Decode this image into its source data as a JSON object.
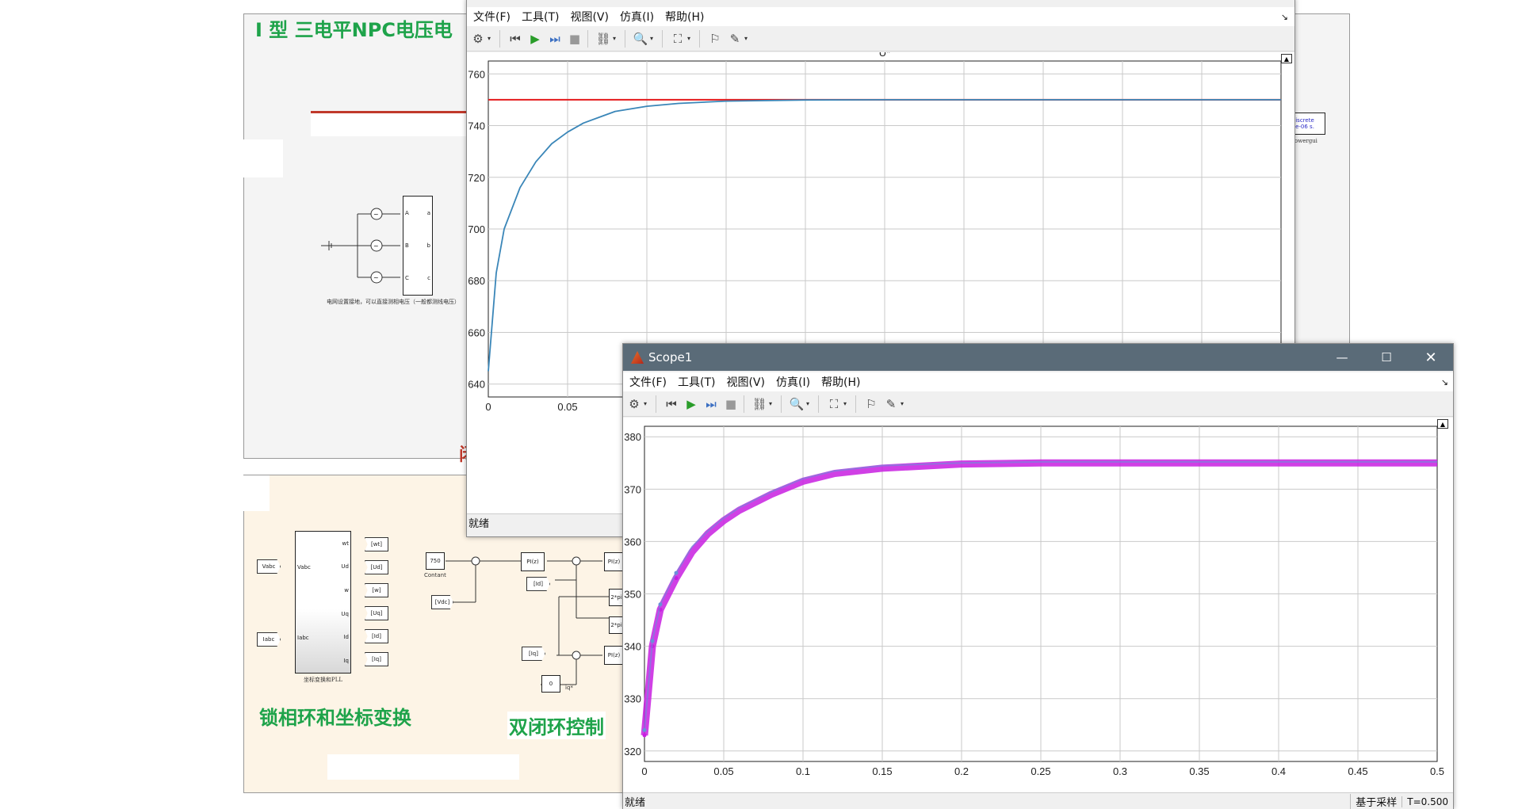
{
  "model": {
    "title_main": "I 型 三电平NPC电压电",
    "grid_note": "电网设置接地，可以直接测相电压（一般都测线电压）",
    "pll_block_label": "坐标变换和PLL",
    "pll_section_title": "锁相环和坐标变换",
    "control_section_title": "双闭环控制",
    "red_partial": "闭",
    "discrete_line1": "iscrete",
    "discrete_line2": "e-06 s.",
    "powergui": "owergui",
    "const_value": "750",
    "const_label": "Contant",
    "zero_value": "0",
    "iq_label": "iq*",
    "pi_label": "PI(z)",
    "gain_label": "2*pi",
    "pll_in": [
      "Vabc",
      "Iabc"
    ],
    "pll_in_ports": [
      "Vabc",
      "Iabc"
    ],
    "pll_out_ports": [
      "wt",
      "Ud",
      "w",
      "Uq",
      "Id",
      "Iq"
    ],
    "pll_out_tags": [
      "[wt]",
      "[Ud]",
      "[w]",
      "[Uq]",
      "[Id]",
      "[Iq]"
    ],
    "ctrl_tags": {
      "vdc": "[Vdc]",
      "id": "[Id]",
      "iq": "[Iq]"
    },
    "source_ports_in": [
      "A",
      "B",
      "C"
    ],
    "source_ports_out": [
      "a",
      "b",
      "c"
    ]
  },
  "win_back": {
    "menu": [
      "文件(F)",
      "工具(T)",
      "视图(V)",
      "仿真(I)",
      "帮助(H)"
    ],
    "status": "就绪"
  },
  "win_front": {
    "title": "Scope1",
    "menu": [
      "文件(F)",
      "工具(T)",
      "视图(V)",
      "仿真(I)",
      "帮助(H)"
    ],
    "status": "就绪",
    "status_right1": "基于采样",
    "status_right2": "T=0.500"
  },
  "icons": [
    "gear-icon",
    "rewind-icon",
    "run-icon",
    "step-icon",
    "stop-icon",
    "highlight-icon",
    "zoom-icon",
    "fit-icon",
    "cursor-icon",
    "edit-icon",
    "minimize-icon",
    "maximize-icon",
    "close-icon",
    "undock-icon",
    "matlab-logo-icon"
  ],
  "colors": {
    "reference": "#e41a1c",
    "measured": "#3a86b8",
    "scope1_a": "#c81ee0",
    "scope1_b": "#6a8fd8",
    "title_bar": "#5a6b78",
    "model_green": "#1ea34a"
  },
  "chart_data": [
    {
      "type": "line",
      "title": "U*",
      "x": [
        0,
        0.005,
        0.01,
        0.02,
        0.03,
        0.04,
        0.05,
        0.06,
        0.08,
        0.1,
        0.12,
        0.15,
        0.2,
        0.25,
        0.3,
        0.35,
        0.4,
        0.45,
        0.5
      ],
      "series": [
        {
          "name": "",
          "color": "#e41a1c",
          "values": [
            750,
            750,
            750,
            750,
            750,
            750,
            750,
            750,
            750,
            750,
            750,
            750,
            750,
            750,
            750,
            750,
            750,
            750,
            750
          ]
        },
        {
          "name": "",
          "color": "#3a86b8",
          "values": [
            645,
            683,
            700,
            716,
            726,
            733,
            737.5,
            741,
            745.5,
            747.5,
            748.6,
            749.5,
            749.9,
            750,
            750,
            750,
            750,
            750,
            750
          ]
        }
      ],
      "x_ticks_visible": [
        "0",
        "0.05"
      ],
      "xlim": [
        0,
        0.5
      ],
      "ylim": [
        635,
        765
      ],
      "y_ticks": [
        640,
        660,
        680,
        700,
        720,
        740,
        760
      ],
      "grid": true
    },
    {
      "type": "line",
      "title": "",
      "x": [
        0,
        0.005,
        0.01,
        0.02,
        0.03,
        0.04,
        0.05,
        0.06,
        0.08,
        0.1,
        0.12,
        0.15,
        0.2,
        0.25,
        0.3,
        0.35,
        0.4,
        0.45,
        0.5
      ],
      "series": [
        {
          "name": "",
          "color": "#c81ee0",
          "values": [
            323,
            340,
            347,
            353,
            358,
            361.5,
            364,
            366,
            369,
            371.5,
            373,
            374,
            374.8,
            375,
            375,
            375,
            375,
            375,
            375
          ]
        },
        {
          "name": "",
          "color": "#6a8fd8",
          "values": [
            324,
            341,
            348,
            354,
            359,
            362,
            364.5,
            366.5,
            369.5,
            372,
            373.5,
            374.5,
            375,
            375.2,
            375.2,
            375.2,
            375.2,
            375.2,
            375.2
          ]
        }
      ],
      "x_ticks": [
        0,
        0.05,
        0.1,
        0.15,
        0.2,
        0.25,
        0.3,
        0.35,
        0.4,
        0.45,
        0.5
      ],
      "xlim": [
        0,
        0.5
      ],
      "ylim": [
        318,
        382
      ],
      "y_ticks": [
        320,
        330,
        340,
        350,
        360,
        370,
        380
      ],
      "grid": true
    }
  ]
}
